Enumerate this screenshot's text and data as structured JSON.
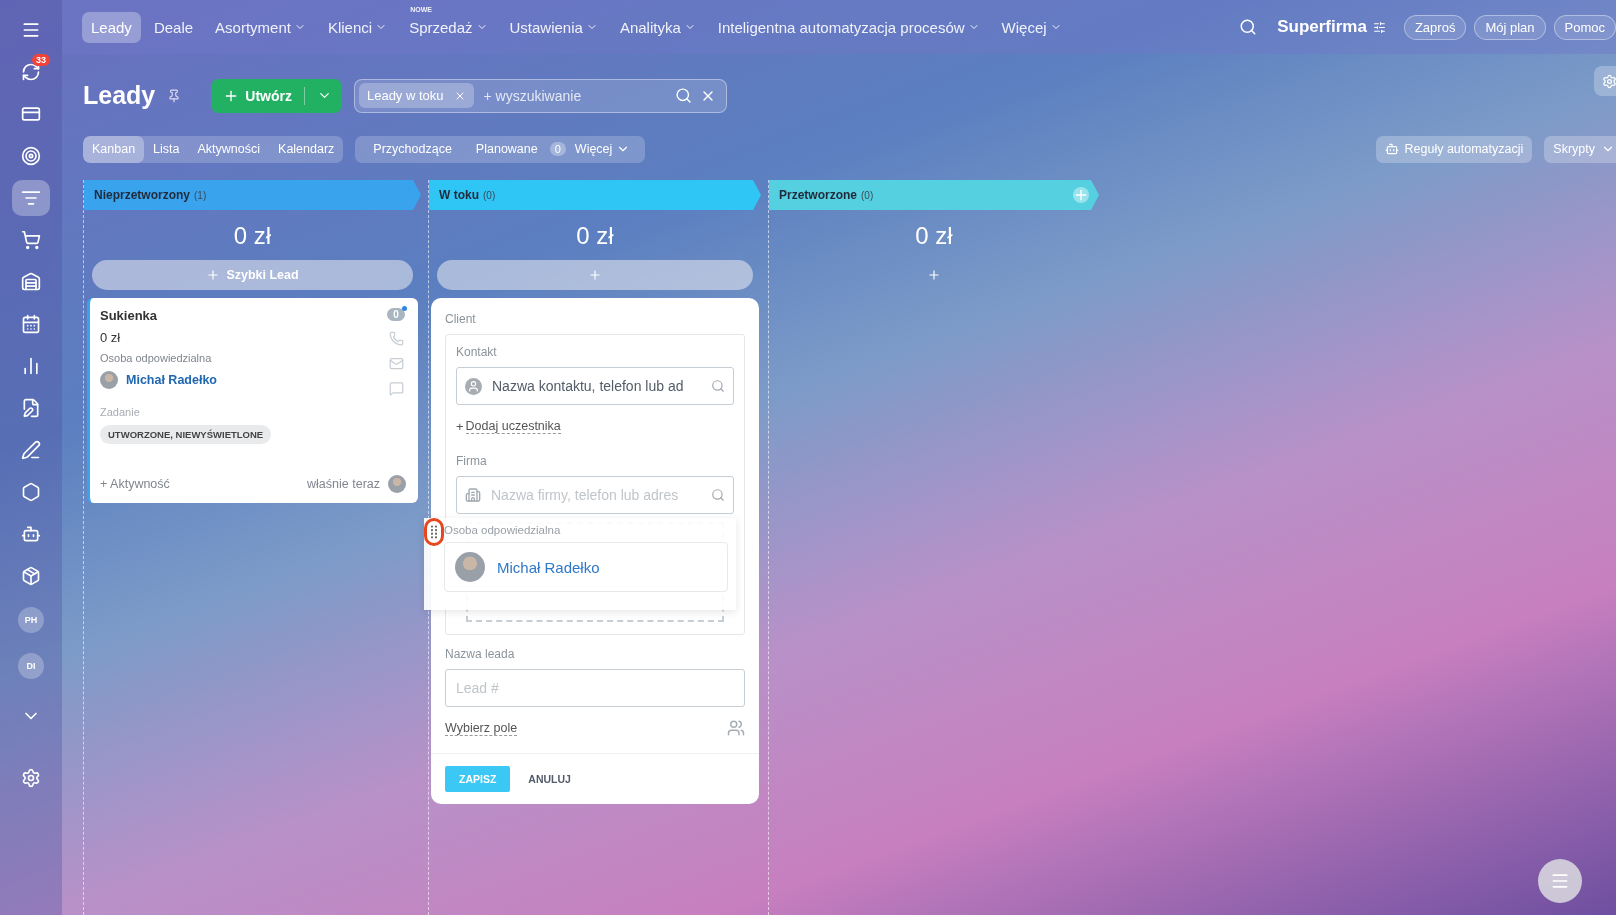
{
  "sidebar": {
    "items": [
      {
        "kind": "icon",
        "selected": false,
        "badge": "33"
      },
      {
        "kind": "icon",
        "selected": false
      },
      {
        "kind": "icon",
        "selected": false
      },
      {
        "kind": "icon",
        "selected": true
      },
      {
        "kind": "icon",
        "selected": false
      },
      {
        "kind": "icon",
        "selected": false
      },
      {
        "kind": "icon",
        "selected": false
      },
      {
        "kind": "icon",
        "selected": false
      },
      {
        "kind": "icon",
        "selected": false
      },
      {
        "kind": "icon",
        "selected": false
      },
      {
        "kind": "icon",
        "selected": false
      },
      {
        "kind": "icon",
        "selected": false
      },
      {
        "kind": "icon",
        "selected": false
      },
      {
        "kind": "avatar",
        "label": "PH",
        "selected": false
      },
      {
        "kind": "avatar",
        "label": "DI",
        "selected": false
      },
      {
        "kind": "icon",
        "selected": false
      }
    ]
  },
  "topnav": {
    "items": [
      {
        "label": "Leady",
        "selected": true,
        "has_menu": false
      },
      {
        "label": "Deale",
        "selected": false,
        "has_menu": false
      },
      {
        "label": "Asortyment",
        "selected": false,
        "has_menu": true
      },
      {
        "label": "Klienci",
        "selected": false,
        "has_menu": true
      },
      {
        "label": "Sprzedaż",
        "selected": false,
        "has_menu": true,
        "badge": "NOWE"
      },
      {
        "label": "Ustawienia",
        "selected": false,
        "has_menu": true
      },
      {
        "label": "Analityka",
        "selected": false,
        "has_menu": true
      },
      {
        "label": "Inteligentna automatyzacja procesów",
        "selected": false,
        "has_menu": true
      },
      {
        "label": "Więcej",
        "selected": false,
        "has_menu": true
      }
    ],
    "brand": "Superfirma",
    "buttons": [
      "Zaproś",
      "Mój plan",
      "Pomoc"
    ]
  },
  "header": {
    "title": "Leady",
    "create_button": "Utwórz",
    "filter_chip": "Leady w toku",
    "search_placeholder": "+ wyszukiwanie"
  },
  "view_tabs": [
    {
      "label": "Kanban",
      "selected": true
    },
    {
      "label": "Lista",
      "selected": false
    },
    {
      "label": "Aktywności",
      "selected": false
    },
    {
      "label": "Kalendarz",
      "selected": false
    }
  ],
  "counters": {
    "items": [
      "Przychodzące",
      "Planowane"
    ],
    "count": "0",
    "more": "Więcej"
  },
  "right_tools": {
    "automation": "Reguły automatyzacji",
    "scripts": "Skrypty"
  },
  "columns": [
    {
      "title": "Nieprzetworzony",
      "count": "(1)",
      "color": "#3aa3ee",
      "amount": "0 zł",
      "add_button": {
        "kind": "bar",
        "label": "Szybki Lead"
      }
    },
    {
      "title": "W toku",
      "count": "(0)",
      "color": "#2fc6f6",
      "amount": "0 zł",
      "add_button": {
        "kind": "bar"
      }
    },
    {
      "title": "Przetworzone",
      "count": "(0)",
      "color": "#55d0e0",
      "amount": "0 zł",
      "add_button": {
        "kind": "plain"
      }
    }
  ],
  "card": {
    "title": "Sukienka",
    "amount": "0 zł",
    "counter": "0",
    "responsible_label": "Osoba odpowiedzialna",
    "responsible_name": "Michał Radełko",
    "task_label": "Zadanie",
    "task_status": "UTWORZONE, NIEWYŚWIETLONE",
    "activity": "+ Aktywność",
    "time": "właśnie teraz"
  },
  "form": {
    "client_label": "Client",
    "contact_label": "Kontakt",
    "contact_placeholder": "Nazwa kontaktu, telefon lub ad",
    "add_plus": "+",
    "add_participant": "Dodaj uczestnika",
    "company_label": "Firma",
    "company_placeholder": "Nazwa firmy, telefon lub adres",
    "lead_name_label": "Nazwa leada",
    "lead_name_placeholder": "Lead #",
    "choose_field": "Wybierz pole",
    "save": "ZAPISZ",
    "cancel": "ANULUJ"
  },
  "drag_ghost": {
    "label": "Osoba odpowiedzialna",
    "name": "Michał Radełko"
  }
}
